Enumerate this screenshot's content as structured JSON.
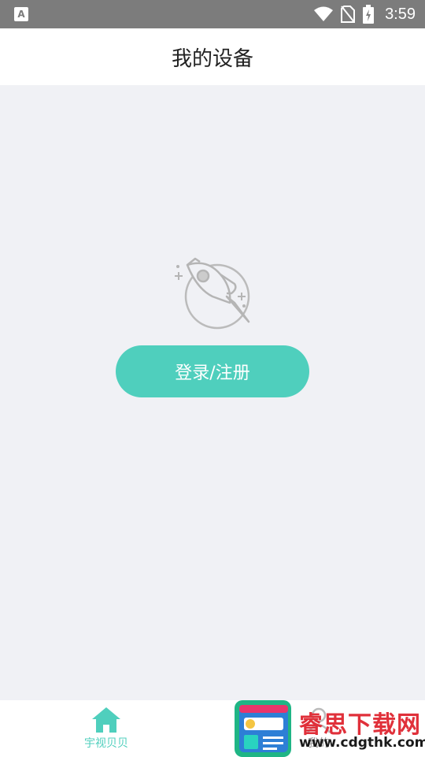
{
  "status_bar": {
    "time": "3:59",
    "left_icon": "A",
    "icons": [
      "wifi-icon",
      "no-sim-icon",
      "battery-charging-icon"
    ]
  },
  "header": {
    "title": "我的设备"
  },
  "main": {
    "illustration": "rocket-icon",
    "login_button_label": "登录/注册"
  },
  "tabbar": {
    "tabs": [
      {
        "label": "宇视贝贝",
        "icon": "home-icon",
        "active": true
      },
      {
        "label": "我的",
        "icon": "user-icon",
        "active": false
      }
    ]
  },
  "watermark": {
    "name": "睿思下载网",
    "url": "www.cdgthk.com"
  },
  "colors": {
    "accent": "#4fcfbd",
    "status_bar": "#7c7c7c",
    "background": "#f0f1f5",
    "watermark_red": "#e0303a"
  }
}
